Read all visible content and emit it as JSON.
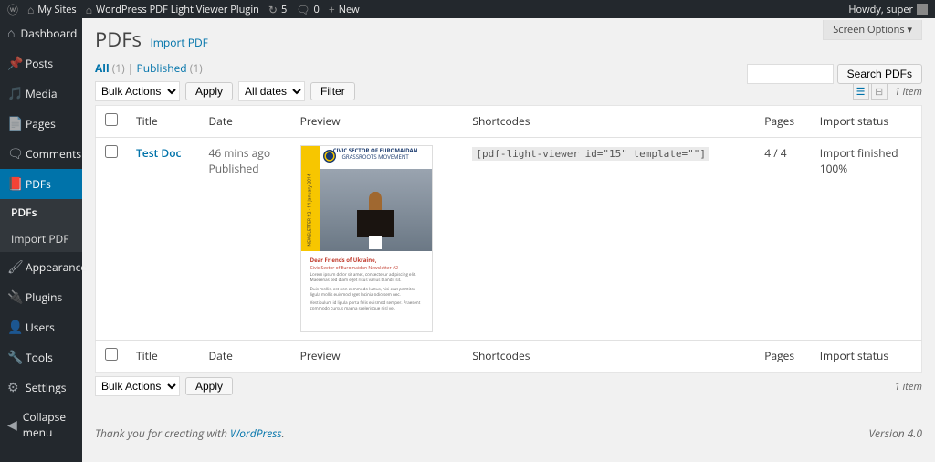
{
  "adminbar": {
    "my_sites": "My Sites",
    "site_name": "WordPress PDF Light Viewer Plugin",
    "updates": "5",
    "comments": "0",
    "new": "New",
    "howdy": "Howdy, super"
  },
  "sidebar": {
    "dashboard": "Dashboard",
    "posts": "Posts",
    "media": "Media",
    "pages": "Pages",
    "comments": "Comments",
    "pdfs": "PDFs",
    "sub_pdfs": "PDFs",
    "sub_import": "Import PDF",
    "appearance": "Appearance",
    "plugins": "Plugins",
    "users": "Users",
    "tools": "Tools",
    "settings": "Settings",
    "collapse": "Collapse menu"
  },
  "screen_options": "Screen Options ▾",
  "page": {
    "title": "PDFs",
    "action": "Import PDF"
  },
  "filters": {
    "all": "All",
    "all_count": "(1)",
    "published": "Published",
    "published_count": "(1)"
  },
  "bulk": {
    "label": "Bulk Actions",
    "apply": "Apply",
    "all_dates": "All dates",
    "filter": "Filter"
  },
  "search": {
    "button": "Search PDFs"
  },
  "count": "1 item",
  "columns": {
    "title": "Title",
    "date": "Date",
    "preview": "Preview",
    "shortcodes": "Shortcodes",
    "pages": "Pages",
    "import_status": "Import status"
  },
  "row": {
    "title": "Test Doc",
    "date_rel": "46 mins ago",
    "date_status": "Published",
    "shortcode": "[pdf-light-viewer id=\"15\" template=\"\"]",
    "pages": "4 / 4",
    "status_line1": "Import finished",
    "status_line2": "100%"
  },
  "preview_doc": {
    "header1": "CIVIC SECTOR OF EUROMAIDAN",
    "header2": "GRASSROOTS MOVEMENT",
    "sidebar_txt": "NEWSLETTER #2 · 14 January 2014",
    "red": "Dear Friends of Ukraine,",
    "red2": "Civic Sector of Euromaidan Newsletter #2"
  },
  "footer": {
    "thanks": "Thank you for creating with ",
    "wp": "WordPress",
    "version": "Version 4.0"
  }
}
